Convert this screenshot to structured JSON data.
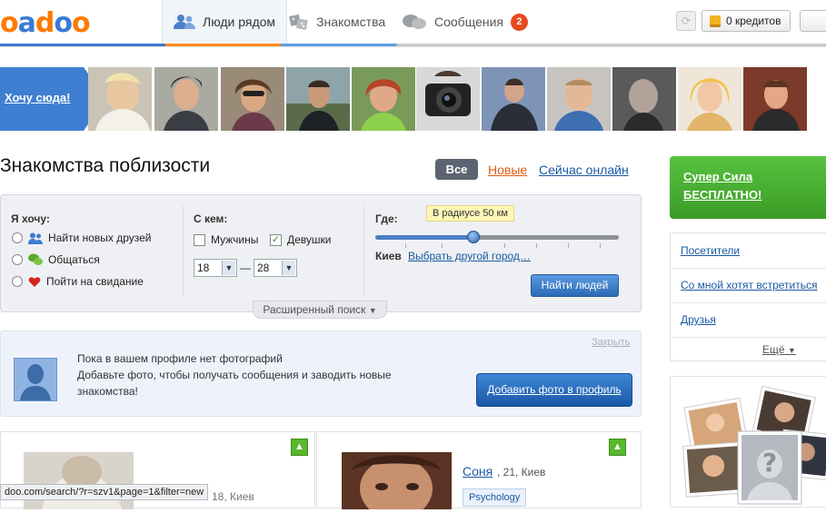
{
  "header": {
    "logo": "oadoo",
    "nav": [
      {
        "label": "Люди рядом",
        "active": true
      },
      {
        "label": "Знакомства",
        "active": false
      },
      {
        "label": "Сообщения",
        "active": false,
        "badge": "2"
      }
    ],
    "credits_label": "0 кредитов"
  },
  "strip": {
    "want_label": "Хочу сюда!"
  },
  "main": {
    "title": "Знакомства поблизости",
    "filters": [
      {
        "label": "Все",
        "active": true
      },
      {
        "label": "Новые"
      },
      {
        "label": "Сейчас онлайн"
      }
    ]
  },
  "search": {
    "want_heading": "Я хочу:",
    "want_options": [
      "Найти новых друзей",
      "Общаться",
      "Пойти на свидание"
    ],
    "with_heading": "С кем:",
    "with_options": [
      {
        "label": "Мужчины",
        "checked": false
      },
      {
        "label": "Девушки",
        "checked": true
      }
    ],
    "age_from": "18",
    "age_to": "28",
    "age_dash": "—",
    "where_heading": "Где:",
    "radius_tooltip": "В радиусе 50 км",
    "city": "Киев",
    "change_city": "Выбрать другой город…",
    "find_button": "Найти людей",
    "advanced": "Расширенный поиск"
  },
  "notice": {
    "line1": "Пока в вашем профиле нет фотографий",
    "line2": "Добавьте фото, чтобы получать сообщения и заводить новые",
    "line3": "знакомства!",
    "close": "Закрыть",
    "add_photo": "Добавить фото в профиль"
  },
  "cards": {
    "left_meta": "18, Киев",
    "right_name": "Соня",
    "right_meta": ", 21, Киев",
    "right_tag": "Psychology"
  },
  "sidebar": {
    "super_line1": "Супер Сила",
    "super_line2": "БЕСПЛАТНО!",
    "items": [
      "Посетители",
      "Со мной хотят встретиться",
      "Друзья"
    ],
    "more": "Ещё"
  },
  "status_url": "doo.com/search/?r=szv1&page=1&filter=new"
}
